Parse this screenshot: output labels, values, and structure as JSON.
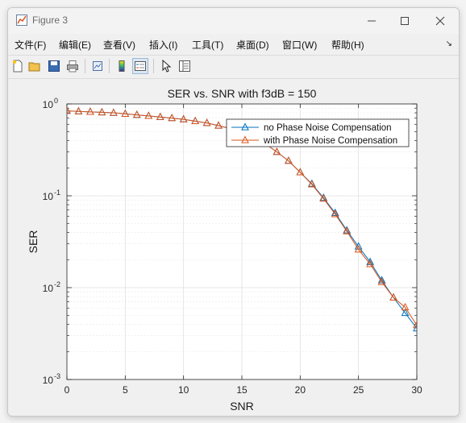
{
  "window": {
    "title": "Figure 3"
  },
  "menu": [
    "文件(F)",
    "编辑(E)",
    "查看(V)",
    "插入(I)",
    "工具(T)",
    "桌面(D)",
    "窗口(W)",
    "帮助(H)"
  ],
  "toolbar_icons": [
    "new-figure-icon",
    "open-file-icon",
    "save-icon",
    "print-icon",
    "link-plot-icon",
    "insert-colorbar-icon",
    "insert-legend-icon",
    "edit-plot-arrow-icon",
    "property-inspector-icon"
  ],
  "colors": {
    "series1": "#0072BD",
    "series2": "#D95319",
    "axes": "#262626",
    "grid": "#dfdfdf"
  },
  "chart_data": {
    "type": "line",
    "title": "SER vs. SNR with f3dB = 150",
    "xlabel": "SNR",
    "ylabel": "SER",
    "xlim": [
      0,
      30
    ],
    "ylim": [
      0.001,
      1
    ],
    "yscale": "log",
    "grid": true,
    "minor_grid": true,
    "legend_position": "top-right",
    "x_ticks": [
      0,
      5,
      10,
      15,
      20,
      25,
      30
    ],
    "y_ticks": [
      {
        "value": 0.001,
        "base": "10",
        "exp": "-3"
      },
      {
        "value": 0.01,
        "base": "10",
        "exp": "-2"
      },
      {
        "value": 0.1,
        "base": "10",
        "exp": "-1"
      },
      {
        "value": 1,
        "base": "10",
        "exp": "0"
      }
    ],
    "x": [
      0,
      1,
      2,
      3,
      4,
      5,
      6,
      7,
      8,
      9,
      10,
      11,
      12,
      13,
      14,
      15,
      16,
      17,
      18,
      19,
      20,
      21,
      22,
      23,
      24,
      25,
      26,
      27,
      28,
      29,
      30
    ],
    "series": [
      {
        "name": "no Phase Noise Compensation",
        "color": "#0072BD",
        "marker": "triangle",
        "values": [
          0.84,
          0.83,
          0.82,
          0.81,
          0.8,
          0.78,
          0.76,
          0.74,
          0.72,
          0.7,
          0.68,
          0.65,
          0.62,
          0.58,
          0.54,
          0.5,
          0.44,
          0.37,
          0.3,
          0.24,
          0.18,
          0.135,
          0.095,
          0.065,
          0.042,
          0.028,
          0.019,
          0.012,
          0.0078,
          0.0053,
          0.0036
        ]
      },
      {
        "name": "with Phase Noise Compensation",
        "color": "#D95319",
        "marker": "triangle",
        "values": [
          0.84,
          0.83,
          0.82,
          0.81,
          0.8,
          0.78,
          0.76,
          0.74,
          0.72,
          0.7,
          0.68,
          0.65,
          0.62,
          0.58,
          0.54,
          0.5,
          0.44,
          0.37,
          0.3,
          0.24,
          0.18,
          0.133,
          0.093,
          0.063,
          0.041,
          0.026,
          0.018,
          0.0115,
          0.0078,
          0.0061,
          0.0039
        ]
      }
    ]
  }
}
